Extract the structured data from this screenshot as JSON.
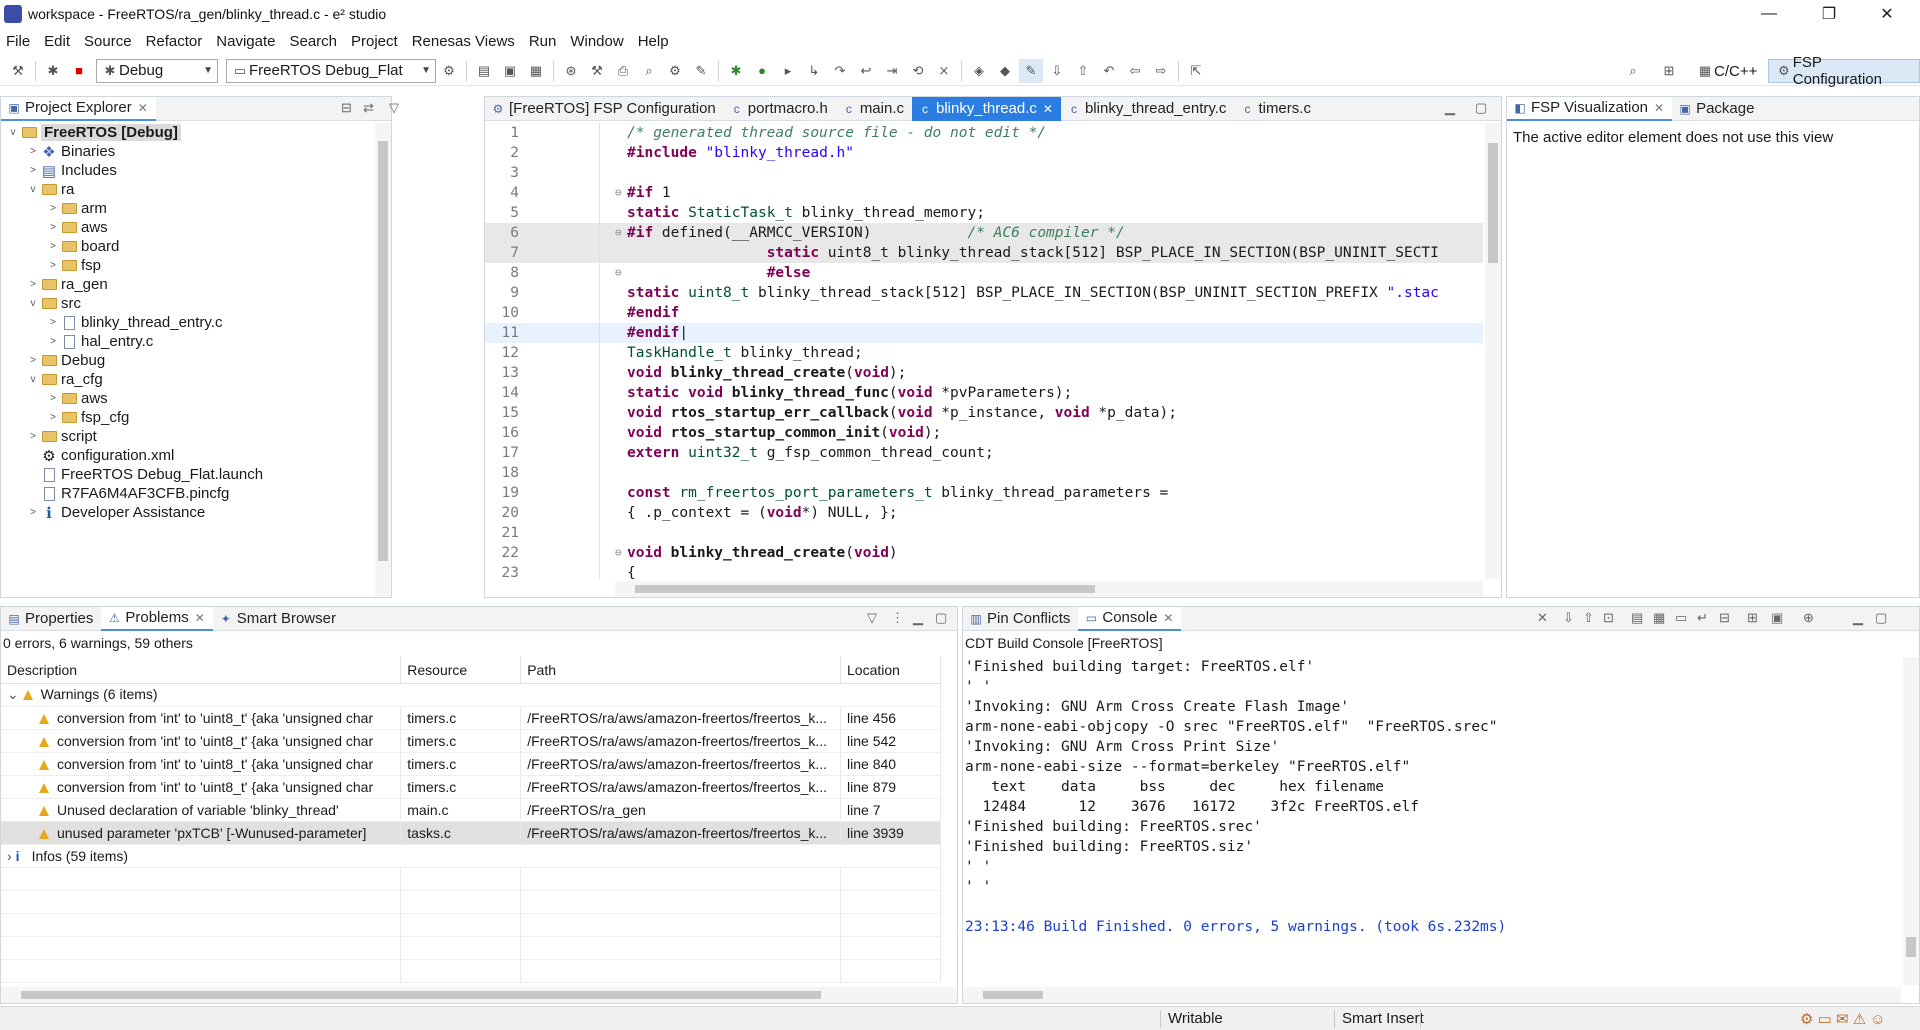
{
  "window": {
    "title": "workspace - FreeRTOS/ra_gen/blinky_thread.c - e² studio",
    "minimize": "—",
    "restore": "❐",
    "close": "✕"
  },
  "menu": [
    "File",
    "Edit",
    "Source",
    "Refactor",
    "Navigate",
    "Search",
    "Project",
    "Renesas Views",
    "Run",
    "Window",
    "Help"
  ],
  "toolbar": {
    "build_config": "Debug",
    "launch_config": "FreeRTOS Debug_Flat",
    "perspectives": [
      "C/C++",
      "FSP Configuration"
    ]
  },
  "explorer": {
    "tab_label": "Project Explorer",
    "items": [
      {
        "label": "FreeRTOS [Debug]",
        "depth": 0,
        "type": "root",
        "expanded": "v"
      },
      {
        "label": "Binaries",
        "depth": 1,
        "type": "binaries",
        "expanded": ">"
      },
      {
        "label": "Includes",
        "depth": 1,
        "type": "includes",
        "expanded": ">"
      },
      {
        "label": "ra",
        "depth": 1,
        "type": "folder",
        "expanded": "v"
      },
      {
        "label": "arm",
        "depth": 2,
        "type": "folder",
        "expanded": ">"
      },
      {
        "label": "aws",
        "depth": 2,
        "type": "folder",
        "expanded": ">"
      },
      {
        "label": "board",
        "depth": 2,
        "type": "folder",
        "expanded": ">"
      },
      {
        "label": "fsp",
        "depth": 2,
        "type": "folder",
        "expanded": ">"
      },
      {
        "label": "ra_gen",
        "depth": 1,
        "type": "folder",
        "expanded": ">"
      },
      {
        "label": "src",
        "depth": 1,
        "type": "folder",
        "expanded": "v"
      },
      {
        "label": "blinky_thread_entry.c",
        "depth": 2,
        "type": "file",
        "expanded": ">"
      },
      {
        "label": "hal_entry.c",
        "depth": 2,
        "type": "file",
        "expanded": ">"
      },
      {
        "label": "Debug",
        "depth": 1,
        "type": "folder",
        "expanded": ">"
      },
      {
        "label": "ra_cfg",
        "depth": 1,
        "type": "folder",
        "expanded": "v"
      },
      {
        "label": "aws",
        "depth": 2,
        "type": "folder",
        "expanded": ">"
      },
      {
        "label": "fsp_cfg",
        "depth": 2,
        "type": "folder",
        "expanded": ">"
      },
      {
        "label": "script",
        "depth": 1,
        "type": "folder",
        "expanded": ">"
      },
      {
        "label": "configuration.xml",
        "depth": 1,
        "type": "config",
        "expanded": ""
      },
      {
        "label": "FreeRTOS Debug_Flat.launch",
        "depth": 1,
        "type": "file",
        "expanded": ""
      },
      {
        "label": "R7FA6M4AF3CFB.pincfg",
        "depth": 1,
        "type": "file",
        "expanded": ""
      },
      {
        "label": "Developer Assistance",
        "depth": 1,
        "type": "assist",
        "expanded": ">"
      }
    ]
  },
  "editor": {
    "tabs": [
      {
        "label": "[FreeRTOS] FSP Configuration",
        "active": false
      },
      {
        "label": "portmacro.h",
        "active": false
      },
      {
        "label": "main.c",
        "active": false
      },
      {
        "label": "blinky_thread.c",
        "active": true
      },
      {
        "label": "blinky_thread_entry.c",
        "active": false
      },
      {
        "label": "timers.c",
        "active": false
      }
    ],
    "lines": [
      {
        "n": "1",
        "fold": "",
        "style": "",
        "segs": [
          [
            "cm",
            "/* generated thread source file - do not edit */"
          ]
        ]
      },
      {
        "n": "2",
        "fold": "",
        "style": "",
        "segs": [
          [
            "pp",
            "#include "
          ],
          [
            "str",
            "\"blinky_thread.h\""
          ]
        ]
      },
      {
        "n": "3",
        "fold": "",
        "style": "",
        "segs": []
      },
      {
        "n": "4",
        "fold": "⊖",
        "style": "",
        "segs": [
          [
            "pp",
            "#if"
          ],
          [
            "",
            " 1"
          ]
        ]
      },
      {
        "n": "5",
        "fold": "",
        "style": "",
        "segs": [
          [
            "kw",
            "static"
          ],
          [
            "",
            " "
          ],
          [
            "ty",
            "StaticTask_t"
          ],
          [
            "",
            " blinky_thread_memory;"
          ]
        ]
      },
      {
        "n": "6",
        "fold": "⊖",
        "style": "hl",
        "segs": [
          [
            "pp",
            "#if"
          ],
          [
            "",
            " defined(__ARMCC_VERSION)           "
          ],
          [
            "cm",
            "/* AC6 compiler */"
          ]
        ]
      },
      {
        "n": "7",
        "fold": "",
        "style": "hl",
        "segs": [
          [
            "",
            "                "
          ],
          [
            "kw",
            "static"
          ],
          [
            "",
            " uint8_t blinky_thread_stack[512] BSP_PLACE_IN_SECTION(BSP_UNINIT_SECTI"
          ]
        ]
      },
      {
        "n": "8",
        "fold": "⊖",
        "style": "",
        "segs": [
          [
            "",
            "                "
          ],
          [
            "pp",
            "#else"
          ]
        ]
      },
      {
        "n": "9",
        "fold": "",
        "style": "",
        "segs": [
          [
            "kw",
            "static"
          ],
          [
            "",
            " "
          ],
          [
            "ty",
            "uint8_t"
          ],
          [
            "",
            " blinky_thread_stack[512] BSP_PLACE_IN_SECTION(BSP_UNINIT_SECTION_PREFIX "
          ],
          [
            "str",
            "\".stac"
          ]
        ]
      },
      {
        "n": "10",
        "fold": "",
        "style": "",
        "segs": [
          [
            "pp",
            "#endif"
          ]
        ]
      },
      {
        "n": "11",
        "fold": "",
        "style": "cur",
        "segs": [
          [
            "pp",
            "#endif"
          ],
          [
            "",
            "|"
          ]
        ]
      },
      {
        "n": "12",
        "fold": "",
        "style": "",
        "segs": [
          [
            "ty",
            "TaskHandle_t"
          ],
          [
            "",
            " blinky_thread;"
          ]
        ]
      },
      {
        "n": "13",
        "fold": "",
        "style": "",
        "segs": [
          [
            "kw",
            "void"
          ],
          [
            "",
            " "
          ],
          [
            "fn",
            "blinky_thread_create"
          ],
          [
            "",
            "("
          ],
          [
            "kw",
            "void"
          ],
          [
            "",
            ");"
          ]
        ]
      },
      {
        "n": "14",
        "fold": "",
        "style": "",
        "segs": [
          [
            "kw",
            "static"
          ],
          [
            "",
            " "
          ],
          [
            "kw",
            "void"
          ],
          [
            "",
            " "
          ],
          [
            "fn",
            "blinky_thread_func"
          ],
          [
            "",
            "("
          ],
          [
            "kw",
            "void"
          ],
          [
            "",
            " *pvParameters);"
          ]
        ]
      },
      {
        "n": "15",
        "fold": "",
        "style": "",
        "segs": [
          [
            "kw",
            "void"
          ],
          [
            "",
            " "
          ],
          [
            "fn",
            "rtos_startup_err_callback"
          ],
          [
            "",
            "("
          ],
          [
            "kw",
            "void"
          ],
          [
            "",
            " *p_instance, "
          ],
          [
            "kw",
            "void"
          ],
          [
            "",
            " *p_data);"
          ]
        ]
      },
      {
        "n": "16",
        "fold": "",
        "style": "",
        "segs": [
          [
            "kw",
            "void"
          ],
          [
            "",
            " "
          ],
          [
            "fn",
            "rtos_startup_common_init"
          ],
          [
            "",
            "("
          ],
          [
            "kw",
            "void"
          ],
          [
            "",
            ");"
          ]
        ]
      },
      {
        "n": "17",
        "fold": "",
        "style": "",
        "segs": [
          [
            "kw",
            "extern"
          ],
          [
            "",
            " "
          ],
          [
            "ty",
            "uint32_t"
          ],
          [
            "",
            " g_fsp_common_thread_count;"
          ]
        ]
      },
      {
        "n": "18",
        "fold": "",
        "style": "",
        "segs": []
      },
      {
        "n": "19",
        "fold": "",
        "style": "",
        "segs": [
          [
            "kw",
            "const"
          ],
          [
            "",
            " "
          ],
          [
            "ty",
            "rm_freertos_port_parameters_t"
          ],
          [
            "",
            " blinky_thread_parameters ="
          ]
        ]
      },
      {
        "n": "20",
        "fold": "",
        "style": "",
        "segs": [
          [
            "",
            "{ .p_context = ("
          ],
          [
            "kw",
            "void"
          ],
          [
            "",
            "*) NULL, };"
          ]
        ]
      },
      {
        "n": "21",
        "fold": "",
        "style": "",
        "segs": []
      },
      {
        "n": "22",
        "fold": "⊖",
        "style": "",
        "segs": [
          [
            "kw",
            "void"
          ],
          [
            "",
            " "
          ],
          [
            "fn",
            "blinky_thread_create"
          ],
          [
            "",
            "("
          ],
          [
            "kw",
            "void"
          ],
          [
            "",
            ")"
          ]
        ]
      },
      {
        "n": "23",
        "fold": "",
        "style": "",
        "segs": [
          [
            "",
            "{"
          ]
        ]
      }
    ]
  },
  "fsp_viz": {
    "tabs": [
      "FSP Visualization",
      "Package"
    ],
    "message": "The active editor element does not use this view"
  },
  "problems": {
    "tabs": [
      "Properties",
      "Problems",
      "Smart Browser"
    ],
    "summary": "0 errors, 6 warnings, 59 others",
    "columns": [
      "Description",
      "Resource",
      "Path",
      "Location"
    ],
    "warnings_group": "Warnings (6 items)",
    "rows": [
      {
        "desc": "conversion from 'int' to 'uint8_t' {aka 'unsigned char",
        "res": "timers.c",
        "path": "/FreeRTOS/ra/aws/amazon-freertos/freertos_k...",
        "loc": "line 456"
      },
      {
        "desc": "conversion from 'int' to 'uint8_t' {aka 'unsigned char",
        "res": "timers.c",
        "path": "/FreeRTOS/ra/aws/amazon-freertos/freertos_k...",
        "loc": "line 542"
      },
      {
        "desc": "conversion from 'int' to 'uint8_t' {aka 'unsigned char",
        "res": "timers.c",
        "path": "/FreeRTOS/ra/aws/amazon-freertos/freertos_k...",
        "loc": "line 840"
      },
      {
        "desc": "conversion from 'int' to 'uint8_t' {aka 'unsigned char",
        "res": "timers.c",
        "path": "/FreeRTOS/ra/aws/amazon-freertos/freertos_k...",
        "loc": "line 879"
      },
      {
        "desc": "Unused declaration of variable 'blinky_thread'",
        "res": "main.c",
        "path": "/FreeRTOS/ra_gen",
        "loc": "line 7"
      },
      {
        "desc": "unused parameter 'pxTCB' [-Wunused-parameter]",
        "res": "tasks.c",
        "path": "/FreeRTOS/ra/aws/amazon-freertos/freertos_k...",
        "loc": "line 3939"
      }
    ],
    "infos_group": "Infos (59 items)"
  },
  "console": {
    "tabs": [
      "Pin Conflicts",
      "Console"
    ],
    "title": "CDT Build Console [FreeRTOS]",
    "lines": [
      "'Finished building target: FreeRTOS.elf'",
      "' '",
      "'Invoking: GNU Arm Cross Create Flash Image'",
      "arm-none-eabi-objcopy -O srec \"FreeRTOS.elf\"  \"FreeRTOS.srec\"",
      "'Invoking: GNU Arm Cross Print Size'",
      "arm-none-eabi-size --format=berkeley \"FreeRTOS.elf\"",
      "   text    data     bss     dec     hex filename",
      "  12484      12    3676   16172    3f2c FreeRTOS.elf",
      "'Finished building: FreeRTOS.srec'",
      "'Finished building: FreeRTOS.siz'",
      "' '",
      "' '",
      "",
      ""
    ],
    "finished": "23:13:46 Build Finished. 0 errors, 5 warnings. (took 6s.232ms)"
  },
  "statusbar": {
    "writable": "Writable",
    "insert_mode": "Smart Insert"
  }
}
